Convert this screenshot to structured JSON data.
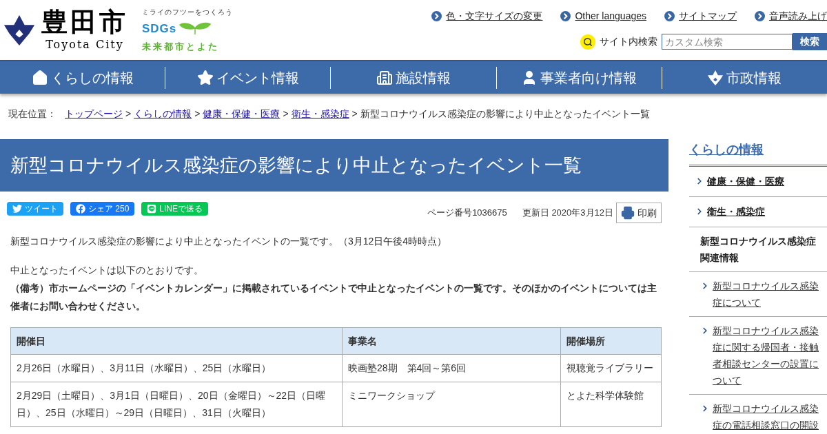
{
  "header": {
    "city_name": "豊田市",
    "city_name_en": "Toyota City",
    "sdgs_tagline": "ミライのフツーをつくろう",
    "sdgs_logo": "SDGs",
    "sdgs_caption": "未来都市とよた",
    "utility_links": [
      "色・文字サイズの変更",
      "Other languages",
      "サイトマップ",
      "音声読み上げ"
    ],
    "search": {
      "label": "サイト内検索",
      "placeholder": "カスタム検索",
      "button": "検索"
    }
  },
  "nav": [
    {
      "label": "くらしの情報",
      "kind": "home"
    },
    {
      "label": "イベント情報",
      "kind": "star"
    },
    {
      "label": "施設情報",
      "kind": "building"
    },
    {
      "label": "事業者向け情報",
      "kind": "person"
    },
    {
      "label": "市政情報",
      "kind": "emblem"
    }
  ],
  "breadcrumb": {
    "prefix": "現在位置：",
    "separator": ">",
    "links": [
      "トップページ",
      "くらしの情報",
      "健康・保健・医療",
      "衛生・感染症"
    ],
    "current": "新型コロナウイルス感染症の影響により中止となったイベント一覧"
  },
  "page_title": "新型コロナウイルス感染症の影響により中止となったイベント一覧",
  "share": [
    {
      "kind": "twitter",
      "label": "ツイート"
    },
    {
      "kind": "facebook",
      "label": "シェア 250"
    },
    {
      "kind": "line",
      "label": "LINEで送る"
    }
  ],
  "page_number": "ページ番号1036675",
  "updated": "更新日 2020年3月12日",
  "print": "印刷",
  "intro": "新型コロナウイルス感染症の影響により中止となったイベントの一覧です。（3月12日午後4時時点）",
  "lead": "中止となったイベントは以下のとおりです。",
  "note": "（備考）市ホームページの「イベントカレンダー」に掲載されているイベントで中止となったイベントの一覧です。そのほかのイベントについては主催者にお問い合わせください。",
  "table": {
    "columns": [
      "開催日",
      "事業名",
      "開催場所"
    ],
    "rows": [
      [
        "2月26日（水曜日）、3月11日（水曜日）、25日（水曜日）",
        "映画塾28期　第4回～第6回",
        "視聴覚ライブラリー"
      ],
      [
        "2月29日（土曜日）、3月1日（日曜日）、20日（金曜日）～22日（日曜日）、25日（水曜日）～29日（日曜日）、31日（火曜日）",
        "ミニワークショップ",
        "とよた科学体験館"
      ]
    ]
  },
  "sidebar": {
    "title": "くらしの情報",
    "items": [
      {
        "kind": "link",
        "label": "健康・保健・医療"
      },
      {
        "kind": "link",
        "label": "衛生・感染症"
      },
      {
        "kind": "heading",
        "label": "新型コロナウイルス感染症関連情報"
      },
      {
        "kind": "sublink",
        "label": "新型コロナウイルス感染症について"
      },
      {
        "kind": "sublink",
        "label": "新型コロナウイルス感染症に関する帰国者・接触者相談センターの設置について"
      },
      {
        "kind": "sublink",
        "label": "新型コロナウイルス感染症の電話相談窓口の開設"
      }
    ]
  }
}
